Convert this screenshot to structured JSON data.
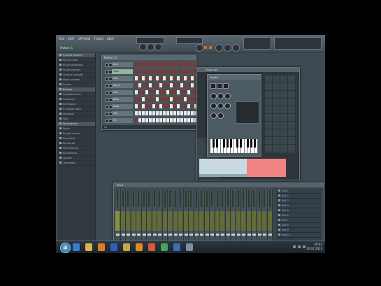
{
  "menu": {
    "items": [
      "FILE",
      "EDIT",
      "OPTIONS",
      "TOOLS",
      "HELP"
    ]
  },
  "toolbar": {
    "hint": "Pattern 1"
  },
  "browser": {
    "items": [
      "Current project",
      "Recent files",
      "Plugin database",
      "Plugin presets",
      "Channel presets",
      "Mixer presets",
      "Scores",
      "Backup",
      "Clipboard files",
      "Collected",
      "Envelopes",
      "IL shared data",
      "Impulses",
      "Misc",
      "My projects",
      "Packs",
      "Project bones",
      "Recorded",
      "Rendered",
      "Sliced beats",
      "Soundfonts",
      "Speech",
      "Templates"
    ],
    "highlighted": [
      0,
      7,
      14
    ]
  },
  "sequencer": {
    "title": "Pattern 1",
    "channels": [
      {
        "name": "Kick",
        "active": false,
        "steps": [
          0,
          0,
          0,
          0,
          0,
          0,
          0,
          0,
          0,
          0,
          0,
          0,
          0,
          0,
          0,
          0,
          0,
          0
        ]
      },
      {
        "name": "Clap",
        "active": true,
        "steps": [
          0,
          0,
          0,
          0,
          0,
          0,
          0,
          0,
          0,
          0,
          0,
          0,
          0,
          0,
          0,
          0,
          0,
          0
        ]
      },
      {
        "name": "Hat",
        "active": false,
        "steps": [
          1,
          0,
          1,
          0,
          1,
          0,
          1,
          0,
          1,
          0,
          1,
          0,
          1,
          0,
          1,
          0,
          1,
          0
        ]
      },
      {
        "name": "Snare",
        "active": false,
        "steps": [
          0,
          1,
          0,
          0,
          1,
          0,
          0,
          1,
          0,
          0,
          1,
          0,
          0,
          1,
          0,
          0,
          1,
          0
        ]
      },
      {
        "name": "Perc",
        "active": false,
        "steps": [
          1,
          0,
          0,
          1,
          0,
          0,
          1,
          0,
          0,
          1,
          0,
          0,
          1,
          0,
          0,
          1,
          0,
          0
        ]
      },
      {
        "name": "Bass",
        "active": false,
        "steps": [
          0,
          0,
          1,
          0,
          0,
          0,
          1,
          0,
          0,
          0,
          1,
          0,
          0,
          0,
          1,
          0,
          0,
          0
        ]
      },
      {
        "name": "Lead",
        "active": false,
        "steps": [
          1,
          0,
          1,
          0,
          0,
          1,
          0,
          1,
          0,
          0,
          1,
          0,
          1,
          0,
          0,
          1,
          0,
          1
        ]
      },
      {
        "name": "Pad",
        "active": false,
        "steps": [
          1,
          1,
          1,
          1,
          1,
          1,
          1,
          1,
          1,
          1,
          1,
          1,
          1,
          1,
          1,
          1,
          1,
          1
        ]
      },
      {
        "name": "FX",
        "active": false,
        "steps": [
          0,
          1,
          1,
          1,
          1,
          1,
          1,
          1,
          1,
          1,
          1,
          1,
          1,
          1,
          1,
          1,
          1,
          1
        ]
      }
    ],
    "footer": "All"
  },
  "piano_roll": {
    "title": "Piano roll"
  },
  "plugin": {
    "title": "Synth",
    "info": ""
  },
  "mixer": {
    "title": "Mixer",
    "strip_count": 30,
    "fx_slots": [
      "Slot 1",
      "Slot 2",
      "Slot 3",
      "Slot 4",
      "Slot 5",
      "Slot 6",
      "Slot 7",
      "Slot 8",
      "Slot 9",
      "Slot 10"
    ]
  },
  "taskbar": {
    "clock_time": "20:42",
    "clock_date": "20.01.2013",
    "pinned_icons": [
      "ie-icon",
      "explorer-icon",
      "media-icon",
      "word-icon",
      "folder-icon",
      "fl-icon",
      "paint-icon",
      "chrome-icon",
      "photoshop-icon",
      "app-icon"
    ],
    "pinned_colors": [
      "#3a7bd5",
      "#d8b34a",
      "#e07a2a",
      "#2f5fb5",
      "#c9a545",
      "#e08a26",
      "#d65a3a",
      "#4aa35b",
      "#3a6fb0",
      "#7c8f9a"
    ]
  }
}
